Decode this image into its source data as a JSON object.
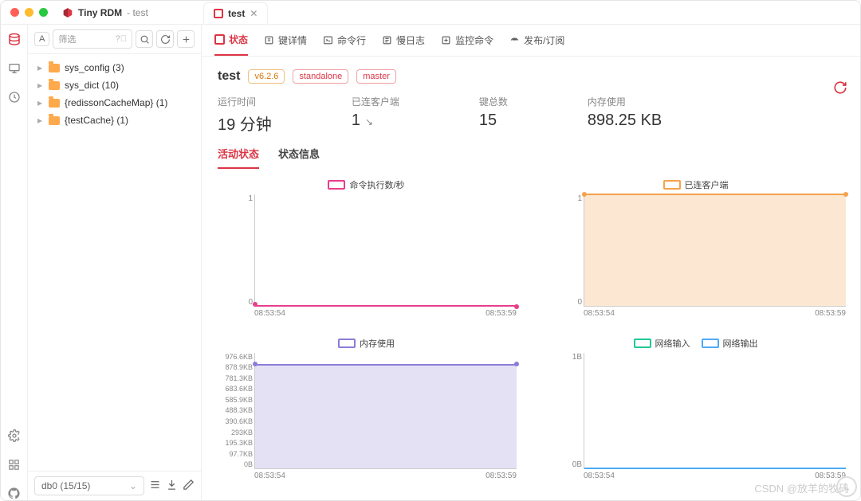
{
  "app": {
    "title": "Tiny RDM",
    "subtitle": "test"
  },
  "tab": {
    "label": "test"
  },
  "search": {
    "placeholder": "筛选",
    "a_label": "A"
  },
  "tree": [
    {
      "label": "sys_config (3)"
    },
    {
      "label": "sys_dict (10)"
    },
    {
      "label": "{redissonCacheMap} (1)"
    },
    {
      "label": "{testCache} (1)"
    }
  ],
  "db_selector": "db0 (15/15)",
  "subtabs": [
    {
      "label": "状态",
      "active": true
    },
    {
      "label": "键详情"
    },
    {
      "label": "命令行"
    },
    {
      "label": "慢日志"
    },
    {
      "label": "监控命令"
    },
    {
      "label": "发布/订阅"
    }
  ],
  "header": {
    "name": "test",
    "badges": [
      "v6.2.6",
      "standalone",
      "master"
    ]
  },
  "stats": [
    {
      "label": "运行时间",
      "value": "19 分钟"
    },
    {
      "label": "已连客户端",
      "value": "1",
      "arrow": "↘"
    },
    {
      "label": "键总数",
      "value": "15"
    },
    {
      "label": "内存使用",
      "value": "898.25 KB"
    }
  ],
  "subtabs2": [
    {
      "label": "活动状态",
      "active": true
    },
    {
      "label": "状态信息"
    }
  ],
  "watermark": "CSDN @放羊的牧码",
  "chart_data": [
    {
      "type": "line",
      "title": "命令执行数/秒",
      "color": "#e83e8c",
      "fill": null,
      "x": [
        "08:53:54",
        "08:53:59"
      ],
      "yticks": [
        "1",
        "0"
      ],
      "values": [
        0,
        0
      ],
      "ylim": [
        0,
        1
      ]
    },
    {
      "type": "area",
      "title": "已连客户端",
      "color": "#f6a24c",
      "fill": "#fce8d2",
      "x": [
        "08:53:54",
        "08:53:59"
      ],
      "yticks": [
        "1",
        "0"
      ],
      "values": [
        1,
        1
      ],
      "ylim": [
        0,
        1
      ]
    },
    {
      "type": "area",
      "title": "内存使用",
      "color": "#8b7dd8",
      "fill": "#e5e1f5",
      "x": [
        "08:53:54",
        "08:53:59"
      ],
      "yticks": [
        "976.6KB",
        "878.9KB",
        "781.3KB",
        "683.6KB",
        "585.9KB",
        "488.3KB",
        "390.6KB",
        "293KB",
        "195.3KB",
        "97.7KB",
        "0B"
      ],
      "values": [
        878.9,
        878.9
      ],
      "ylim": [
        0,
        976.6
      ]
    },
    {
      "type": "line",
      "title_multi": [
        "网络输入",
        "网络输出"
      ],
      "colors": [
        "#20c997",
        "#4dabf7"
      ],
      "x": [
        "08:53:54",
        "08:53:59"
      ],
      "yticks": [
        "1B",
        "0B"
      ],
      "series": [
        {
          "name": "网络输入",
          "values": [
            0,
            0
          ]
        },
        {
          "name": "网络输出",
          "values": [
            0,
            0
          ]
        }
      ],
      "ylim": [
        0,
        1
      ]
    }
  ]
}
